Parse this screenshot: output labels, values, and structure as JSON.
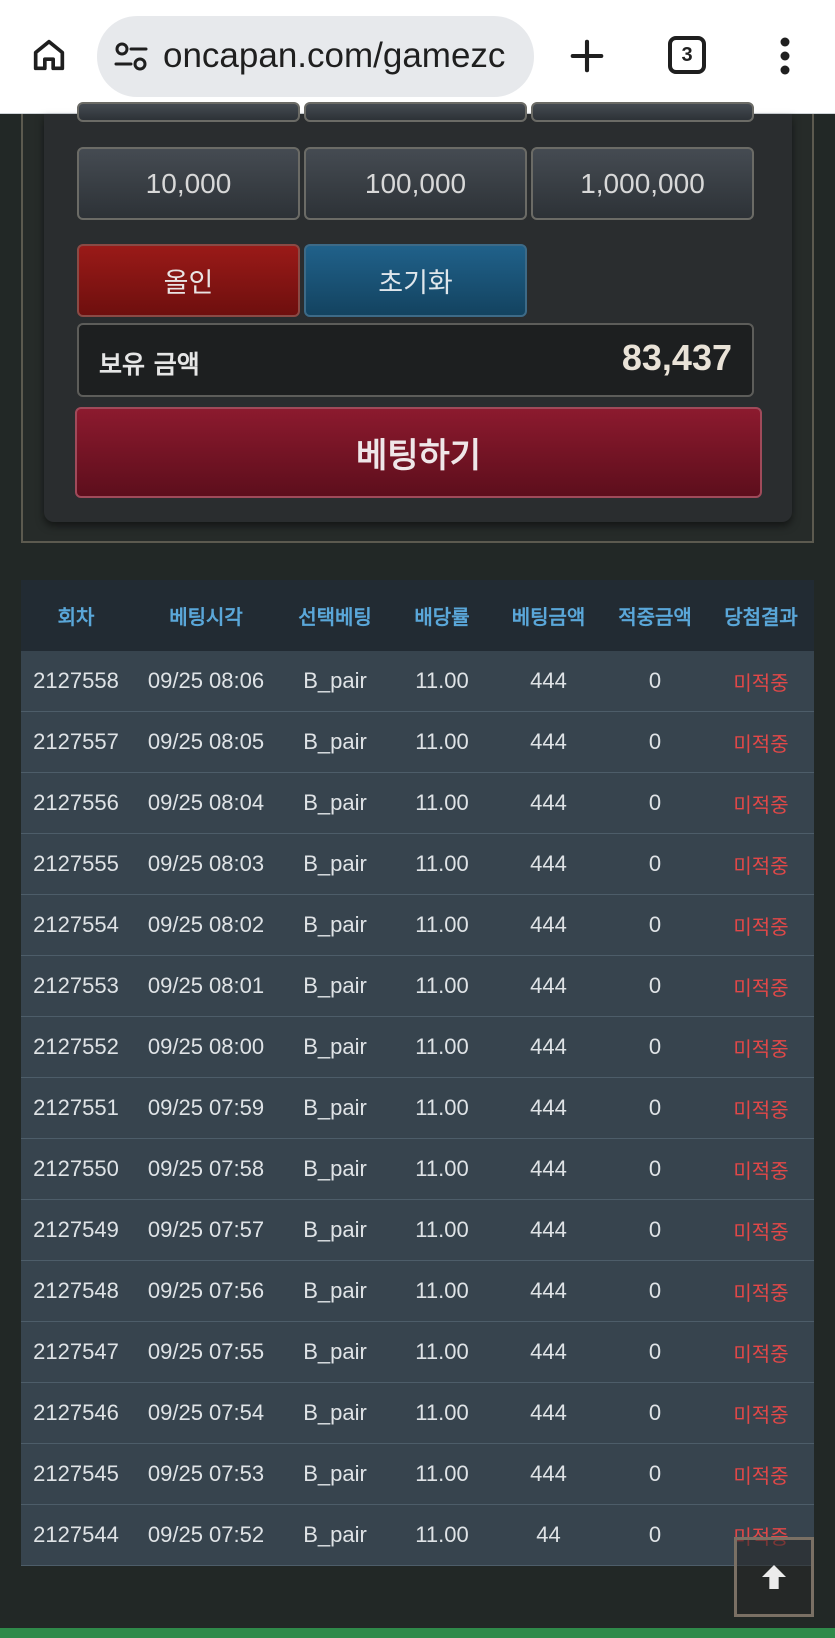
{
  "browser": {
    "url": "oncapan.com/gamezc",
    "tab_count": "3",
    "icons": {
      "home": "home-icon",
      "site_settings": "site-settings-icon",
      "new_tab": "plus-icon",
      "menu": "more-vert-icon"
    }
  },
  "betting": {
    "chips": [
      "10,000",
      "100,000",
      "1,000,000"
    ],
    "allin_label": "올인",
    "reset_label": "초기화",
    "balance_label": "보유 금액",
    "balance_value": "83,437",
    "bet_label": "베팅하기",
    "colors": {
      "allin": "#8c1616",
      "reset": "#1b5a80",
      "bet": "#7a1426"
    }
  },
  "history": {
    "headers": [
      "회차",
      "베팅시각",
      "선택베팅",
      "배당률",
      "베팅금액",
      "적중금액",
      "당첨결과"
    ],
    "rows": [
      [
        "2127558",
        "09/25 08:06",
        "B_pair",
        "11.00",
        "444",
        "0",
        "미적중"
      ],
      [
        "2127557",
        "09/25 08:05",
        "B_pair",
        "11.00",
        "444",
        "0",
        "미적중"
      ],
      [
        "2127556",
        "09/25 08:04",
        "B_pair",
        "11.00",
        "444",
        "0",
        "미적중"
      ],
      [
        "2127555",
        "09/25 08:03",
        "B_pair",
        "11.00",
        "444",
        "0",
        "미적중"
      ],
      [
        "2127554",
        "09/25 08:02",
        "B_pair",
        "11.00",
        "444",
        "0",
        "미적중"
      ],
      [
        "2127553",
        "09/25 08:01",
        "B_pair",
        "11.00",
        "444",
        "0",
        "미적중"
      ],
      [
        "2127552",
        "09/25 08:00",
        "B_pair",
        "11.00",
        "444",
        "0",
        "미적중"
      ],
      [
        "2127551",
        "09/25 07:59",
        "B_pair",
        "11.00",
        "444",
        "0",
        "미적중"
      ],
      [
        "2127550",
        "09/25 07:58",
        "B_pair",
        "11.00",
        "444",
        "0",
        "미적중"
      ],
      [
        "2127549",
        "09/25 07:57",
        "B_pair",
        "11.00",
        "444",
        "0",
        "미적중"
      ],
      [
        "2127548",
        "09/25 07:56",
        "B_pair",
        "11.00",
        "444",
        "0",
        "미적중"
      ],
      [
        "2127547",
        "09/25 07:55",
        "B_pair",
        "11.00",
        "444",
        "0",
        "미적중"
      ],
      [
        "2127546",
        "09/25 07:54",
        "B_pair",
        "11.00",
        "444",
        "0",
        "미적중"
      ],
      [
        "2127545",
        "09/25 07:53",
        "B_pair",
        "11.00",
        "444",
        "0",
        "미적중"
      ],
      [
        "2127544",
        "09/25 07:52",
        "B_pair",
        "11.00",
        "44",
        "0",
        "미적중"
      ]
    ],
    "result_color": "#e24848",
    "header_color": "#5aa7d9"
  },
  "scroll_top_icon": "arrow-up-icon"
}
